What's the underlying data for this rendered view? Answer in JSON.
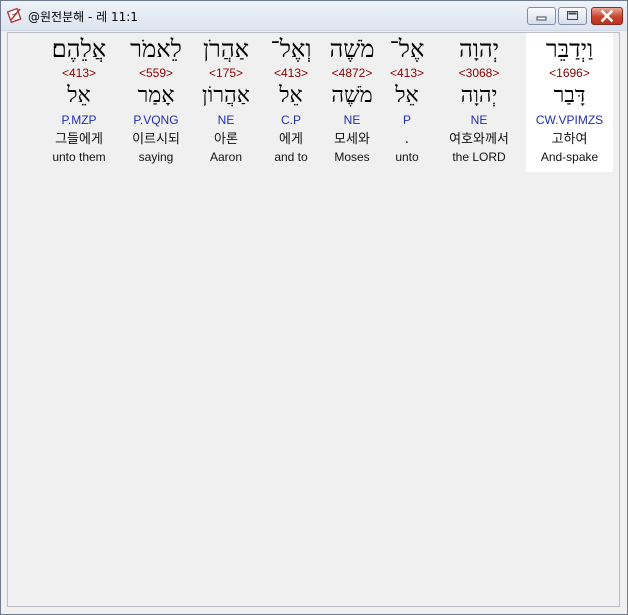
{
  "window": {
    "title": "@원전분해 - 레 11:1",
    "icon": "app-book-pen-icon"
  },
  "words": [
    {
      "hebrew": "וַיְדַבֵּר",
      "strong": "<1696>",
      "lemma": "דָּבַר",
      "morph": "CW.VPIMZS",
      "korean": "고하여",
      "english": "And-spake",
      "selected": true
    },
    {
      "hebrew": "יְהוָה",
      "strong": "<3068>",
      "lemma": "יְהוָה",
      "morph": "NE",
      "korean": "여호와께서",
      "english": "the LORD",
      "selected": false
    },
    {
      "hebrew": "אֶל־",
      "strong": "<413>",
      "lemma": "אֵל",
      "morph": "P",
      "korean": ".",
      "english": "unto",
      "selected": false
    },
    {
      "hebrew": "מֹשֶׁה",
      "strong": "<4872>",
      "lemma": "מֹשֶׁה",
      "morph": "NE",
      "korean": "모세와",
      "english": "Moses",
      "selected": false
    },
    {
      "hebrew": "וְאֶל־",
      "strong": "<413>",
      "lemma": "אֵל",
      "morph": "C.P",
      "korean": "에게",
      "english": "and to",
      "selected": false
    },
    {
      "hebrew": "אַהֲרֹן",
      "strong": "<175>",
      "lemma": "אַהֲרוֹן",
      "morph": "NE",
      "korean": "아론",
      "english": "Aaron",
      "selected": false
    },
    {
      "hebrew": "לֵאמֹר",
      "strong": "<559>",
      "lemma": "אָמַר",
      "morph": "P.VQNG",
      "korean": "이르시되",
      "english": "saying",
      "selected": false
    },
    {
      "hebrew": "אֲלֵהֶם׃",
      "strong": "<413>",
      "lemma": "אֵל",
      "morph": "P.MZP",
      "korean": "그들에게",
      "english": "unto them",
      "selected": false
    }
  ]
}
